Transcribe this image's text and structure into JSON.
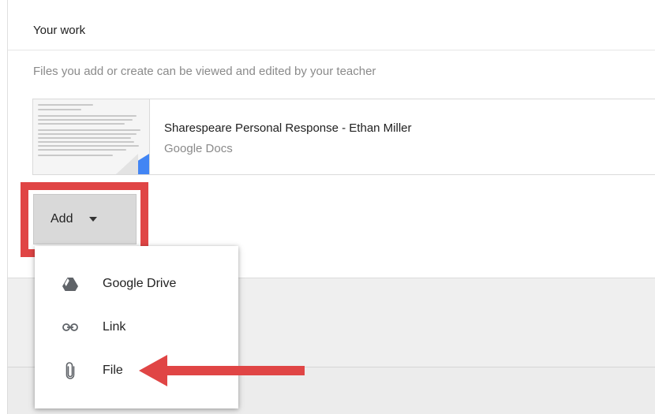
{
  "your_work": {
    "title": "Your work",
    "hint": "Files you add or create can be viewed and edited by your teacher"
  },
  "attachment": {
    "title": "Sharespeare Personal Response - Ethan Miller",
    "subtitle": "Google Docs"
  },
  "add_button": {
    "label": "Add",
    "icon": "caret-down-icon"
  },
  "add_menu": {
    "items": [
      {
        "label": "Google Drive",
        "icon": "google-drive-icon"
      },
      {
        "label": "Link",
        "icon": "link-icon"
      },
      {
        "label": "File",
        "icon": "paperclip-icon"
      }
    ]
  },
  "annotations": {
    "highlight_color": "#e04545",
    "arrow_color": "#e04545"
  }
}
